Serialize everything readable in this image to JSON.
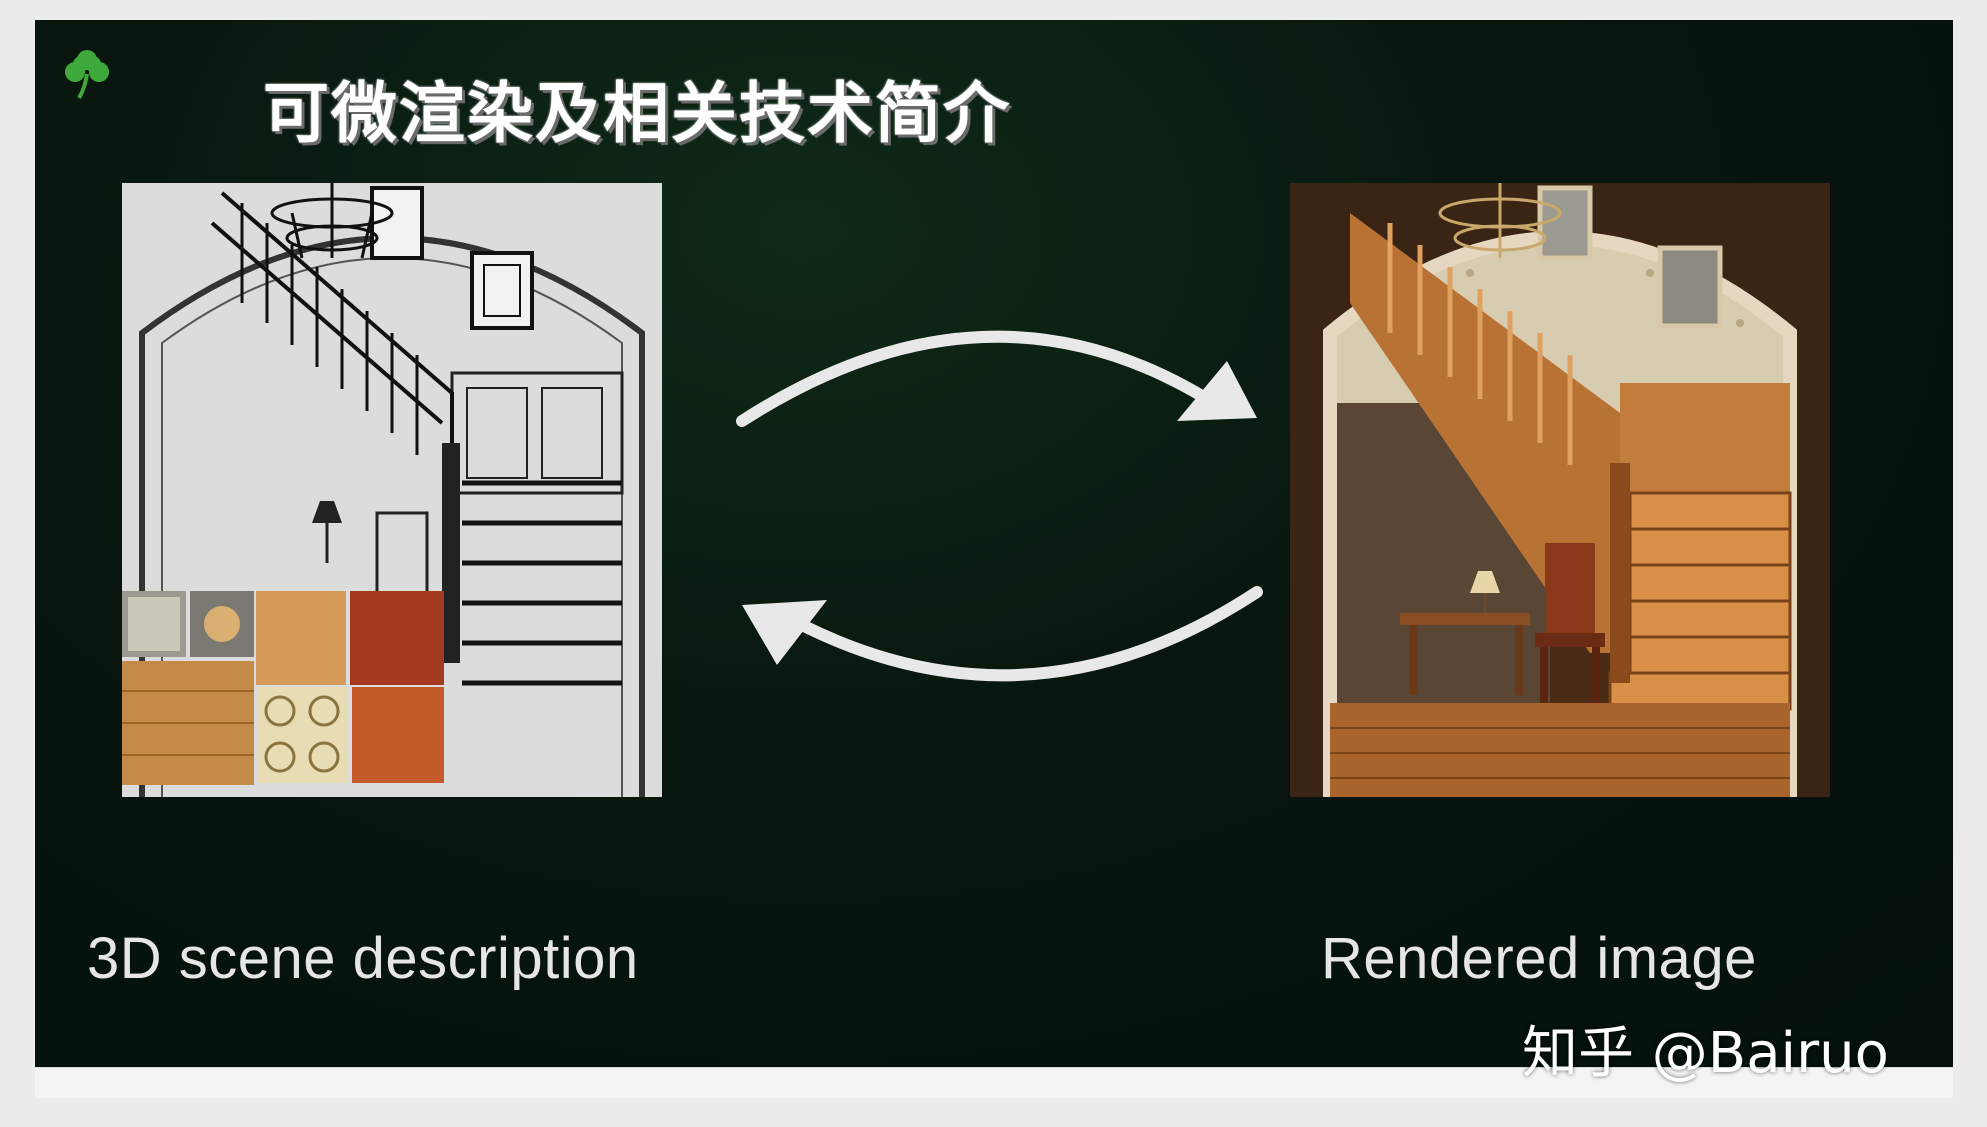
{
  "slide": {
    "title": "可微渲染及相关技术简介",
    "logo_icon": "clover-leaf-icon",
    "left_caption": "3D scene description",
    "right_caption": "Rendered image",
    "watermark": "知乎 @Bairuo",
    "arrow_top_icon": "curved-arrow-right-icon",
    "arrow_bottom_icon": "curved-arrow-left-icon"
  },
  "colors": {
    "background": "#05100c",
    "accent_green": "#3fa83a",
    "arrow": "#e8e8e8",
    "text": "#ffffff"
  }
}
